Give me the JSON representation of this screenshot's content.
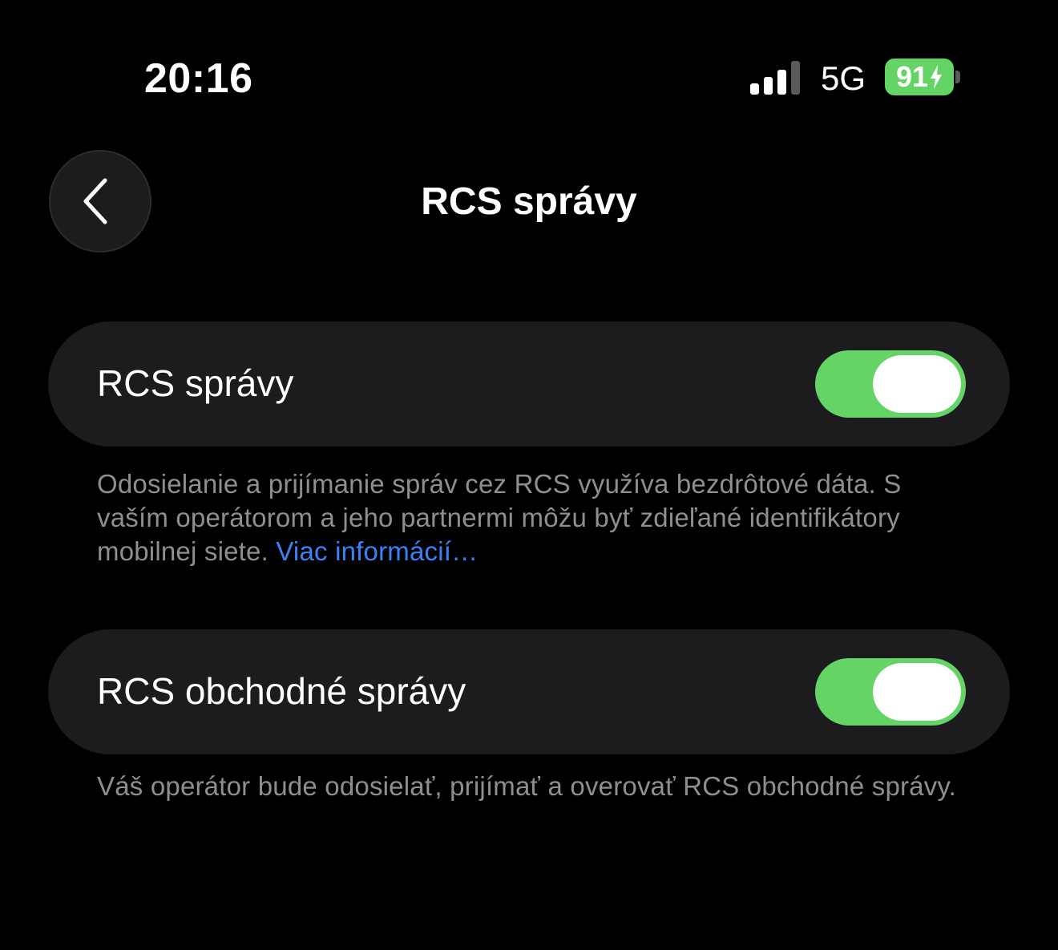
{
  "status_bar": {
    "time": "20:16",
    "signal_bars_active": 3,
    "signal_bars_total": 4,
    "network": "5G",
    "battery_level": "91",
    "charging": true,
    "battery_color": "#64d466"
  },
  "nav": {
    "back_icon": "chevron-left-icon",
    "title": "RCS správy"
  },
  "settings": {
    "rcs_messages": {
      "label": "RCS správy",
      "enabled": true,
      "footer": "Odosielanie a prijímanie správ cez RCS využíva bezdrôtové dáta. S vaším operátorom a jeho partnermi môžu byť zdieľané identifikátory mobilnej siete. ",
      "footer_link": "Viac informácií…"
    },
    "rcs_business_messages": {
      "label": "RCS obchodné správy",
      "enabled": true,
      "footer": "Váš operátor bude odosielať, prijímať a overovať RCS obchodné správy."
    }
  },
  "colors": {
    "background": "#000000",
    "row_background": "#1c1c1e",
    "toggle_on": "#64d466",
    "secondary_text": "#8e8e93",
    "link": "#3b82f6"
  }
}
